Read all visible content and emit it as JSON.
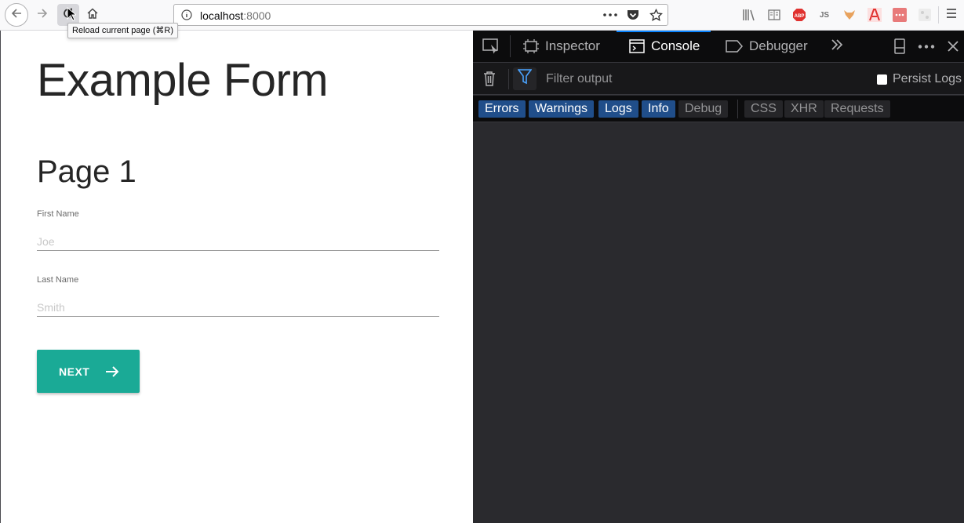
{
  "browser": {
    "url_host": "localhost",
    "url_port": ":8000",
    "tooltip": "Reload current page (⌘R)",
    "extension_js_label": "JS"
  },
  "page": {
    "title": "Example Form",
    "section_title": "Page 1",
    "fields": [
      {
        "label": "First Name",
        "placeholder": "Joe"
      },
      {
        "label": "Last Name",
        "placeholder": "Smith"
      }
    ],
    "next_label": "NEXT"
  },
  "devtools": {
    "tabs": [
      {
        "label": "Inspector",
        "icon": "inspector-icon"
      },
      {
        "label": "Console",
        "icon": "console-icon",
        "active": true
      },
      {
        "label": "Debugger",
        "icon": "debugger-icon"
      }
    ],
    "filter_placeholder": "Filter output",
    "persist_logs_label": "Persist Logs",
    "levels": [
      {
        "label": "Errors",
        "on": true
      },
      {
        "label": "Warnings",
        "on": true
      },
      {
        "label": "Logs",
        "on": true
      },
      {
        "label": "Info",
        "on": true
      },
      {
        "label": "Debug",
        "on": false
      }
    ],
    "types": [
      {
        "label": "CSS"
      },
      {
        "label": "XHR"
      },
      {
        "label": "Requests"
      }
    ]
  },
  "colors": {
    "accent_button": "#1aaa96",
    "devtools_active_tab": "#0a84ff",
    "level_on": "#204e8a"
  }
}
